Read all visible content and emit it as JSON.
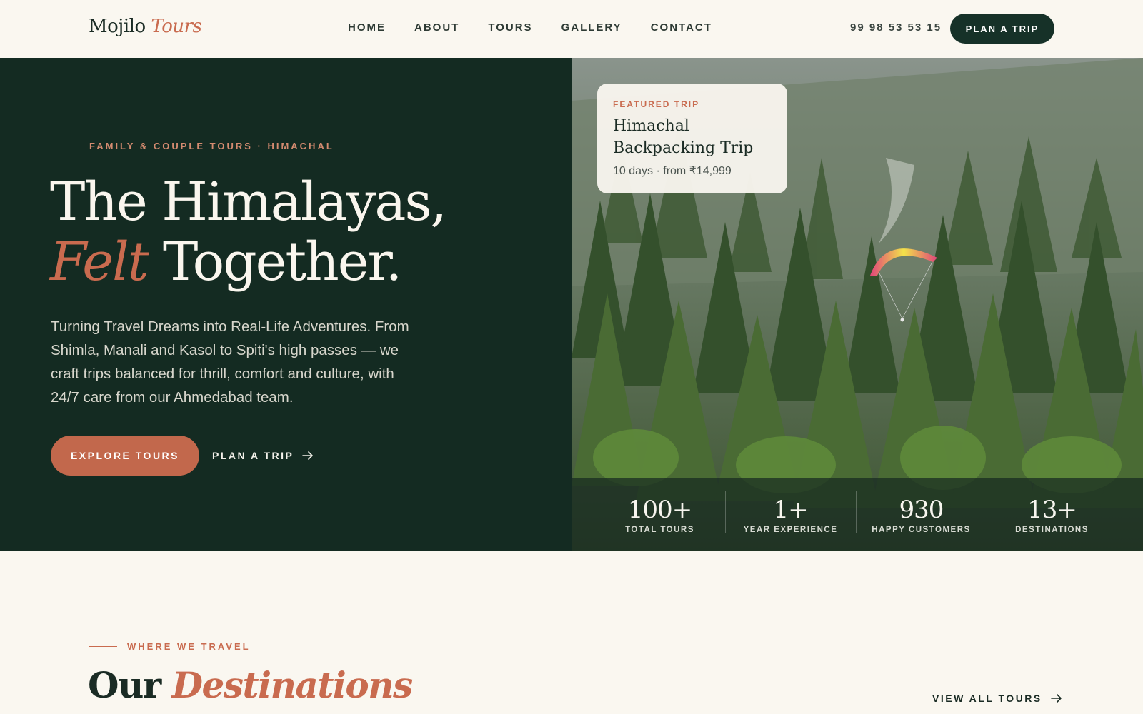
{
  "header": {
    "logo_main": "Mojilo",
    "logo_accent": "Tours",
    "nav": [
      "HOME",
      "ABOUT",
      "TOURS",
      "GALLERY",
      "CONTACT"
    ],
    "phone": "99 98 53 53 15",
    "cta": "PLAN A TRIP"
  },
  "hero": {
    "eyebrow": "FAMILY & COUPLE TOURS · HIMACHAL",
    "headline_line1": "The Himalayas,",
    "headline_accent": "Felt",
    "headline_line2_rest": "Together.",
    "lead": "Turning Travel Dreams into Real-Life Adventures. From Shimla, Manali and Kasol to Spiti's high passes — we craft trips balanced for thrill, comfort and culture, with 24/7 care from our Ahmedabad team.",
    "primary_cta": "EXPLORE TOURS",
    "secondary_cta": "PLAN A TRIP"
  },
  "featured": {
    "tag": "FEATURED TRIP",
    "title": "Himachal Backpacking Trip",
    "meta": "10 days · from ₹14,999"
  },
  "stats": [
    {
      "num": "100+",
      "label": "TOTAL TOURS"
    },
    {
      "num": "1+",
      "label": "YEAR EXPERIENCE"
    },
    {
      "num": "930",
      "label": "HAPPY CUSTOMERS"
    },
    {
      "num": "13+",
      "label": "DESTINATIONS"
    }
  ],
  "destinations": {
    "eyebrow": "WHERE WE TRAVEL",
    "title_main": "Our",
    "title_accent": "Destinations",
    "view_all": "VIEW ALL TOURS"
  },
  "icons": {
    "arrow": "arrow-right-icon",
    "paraglider": "paraglider-image"
  },
  "colors": {
    "dark_green": "#142b22",
    "terracotta": "#c96b4f",
    "cream": "#faf7f0"
  }
}
